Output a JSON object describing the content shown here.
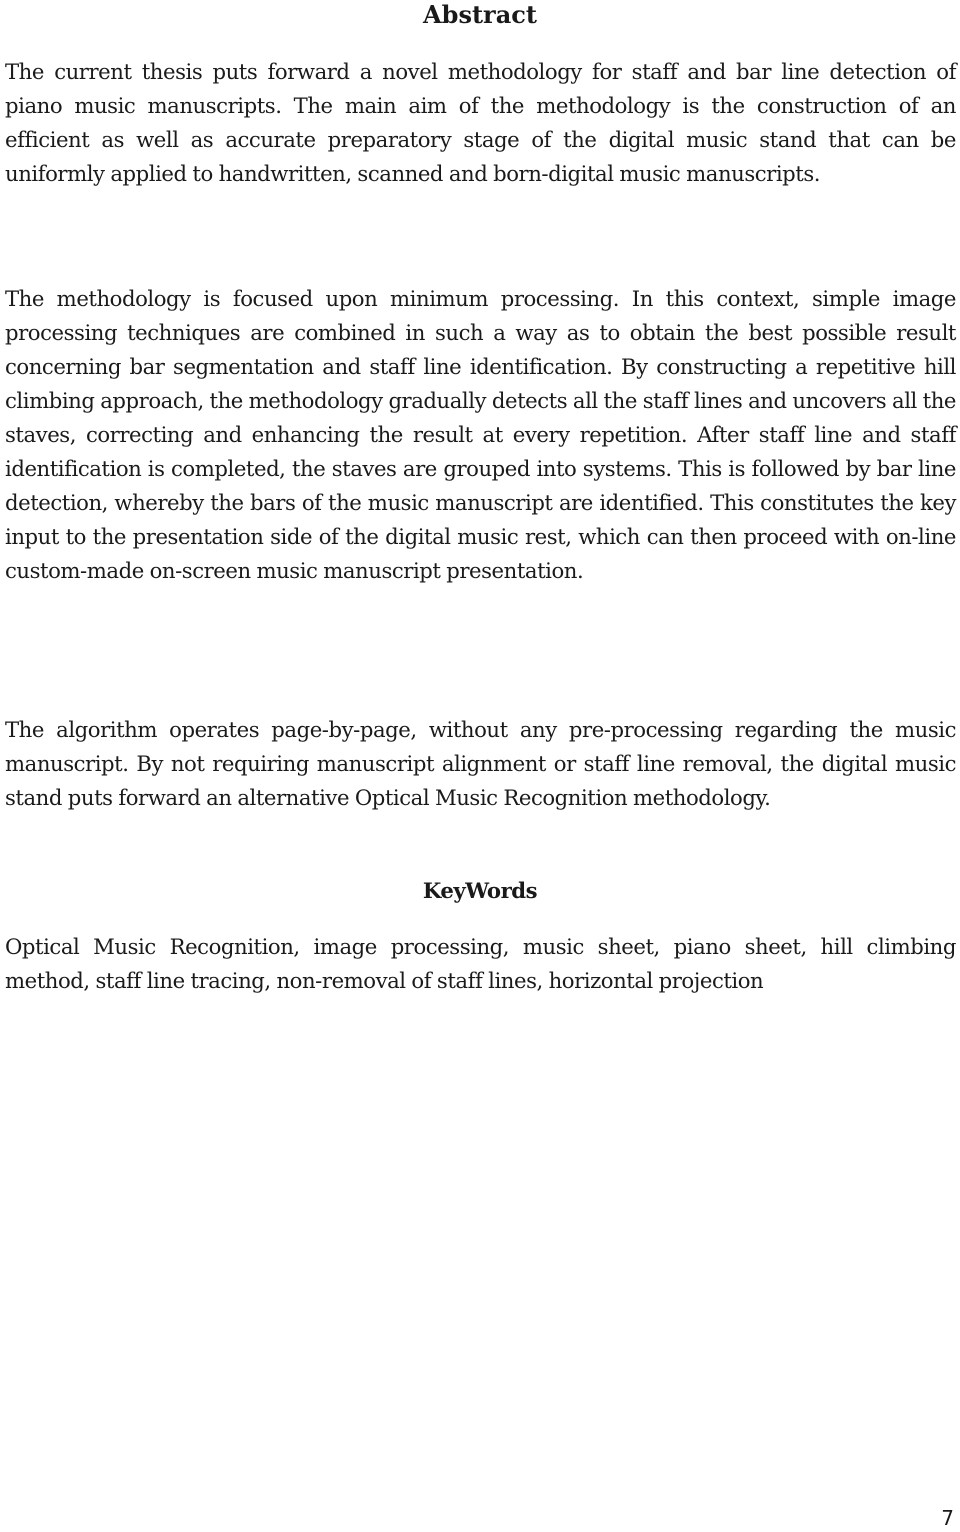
{
  "document": {
    "title": "Abstract",
    "paragraphs": [
      "The current thesis puts forward a novel methodology for staff and bar line detection of piano music manuscripts. The main aim of the methodology is the construction of an efficient as well as accurate preparatory stage of the digital music stand that can be uniformly applied to handwritten, scanned and born-digital music manuscripts.",
      "The methodology is focused upon minimum processing. In this context, simple image processing techniques are combined in such a way as to obtain the best possible result concerning bar segmentation and staff line identification. By constructing a repetitive hill climbing approach, the methodology gradually detects all the staff lines and uncovers all the staves, correcting and enhancing the result at every repetition. After staff line and staff identification is completed, the staves are grouped into systems. This is followed by bar line detection, whereby the bars of the music manuscript are identified. This constitutes the key input to the presentation side of the digital music rest, which can then proceed with on-line custom-made on-screen music manuscript presentation.",
      "The algorithm operates page-by-page, without any pre-processing regarding the music manuscript. By not requiring manuscript alignment or staff line removal, the digital music stand puts forward an alternative Optical Music Recognition methodology."
    ],
    "keywords_heading": "KeyWords",
    "keywords": "Optical Music Recognition, image processing, music sheet, piano sheet, hill climbing method, staff line tracing, non-removal of staff lines, horizontal projection",
    "page_number": "7"
  }
}
